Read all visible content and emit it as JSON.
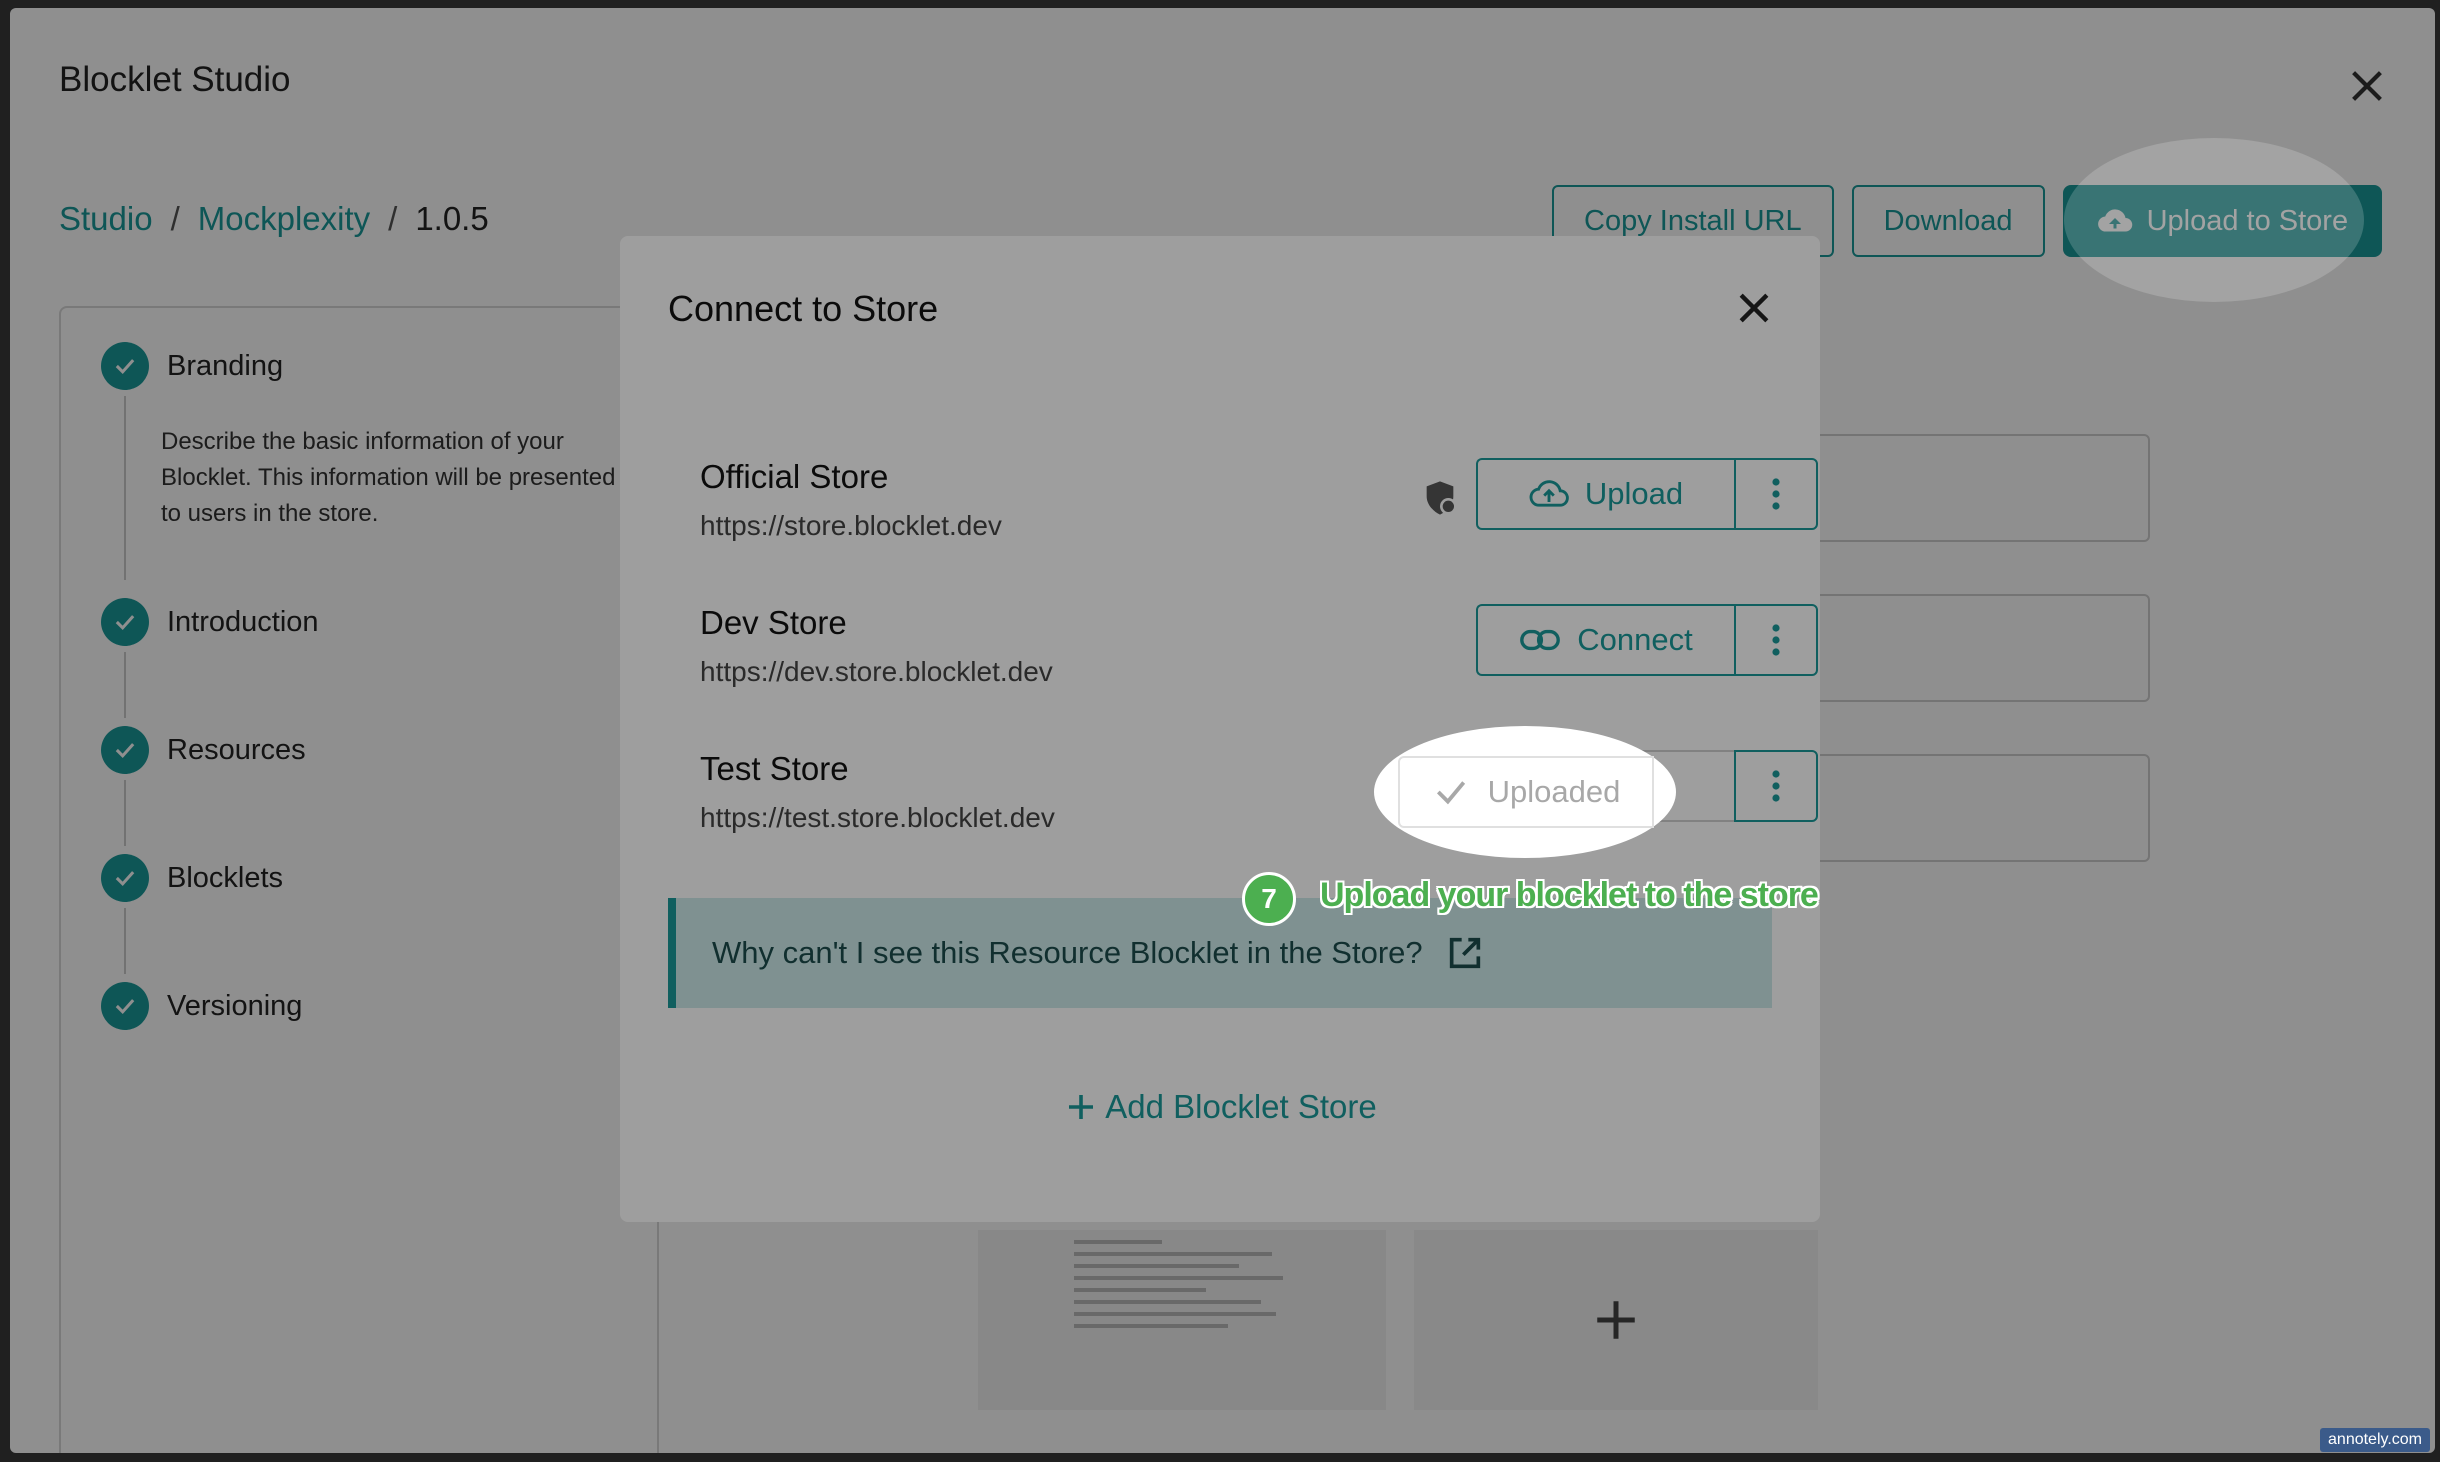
{
  "app": {
    "title": "Blocklet Studio"
  },
  "breadcrumb": {
    "items": [
      "Studio",
      "Mockplexity",
      "1.0.5"
    ],
    "separator": "/"
  },
  "toolbar": {
    "copy_install_url": "Copy Install URL",
    "download": "Download",
    "upload_to_store": "Upload to Store"
  },
  "steps": [
    {
      "label": "Branding",
      "description": "Describe the basic information of your Blocklet. This information will be presented to users in the store."
    },
    {
      "label": "Introduction"
    },
    {
      "label": "Resources"
    },
    {
      "label": "Blocklets"
    },
    {
      "label": "Versioning"
    }
  ],
  "modal": {
    "title": "Connect to Store",
    "stores": [
      {
        "name": "Official Store",
        "url": "https://store.blocklet.dev",
        "action": "Upload",
        "action_icon": "cloud-upload-icon"
      },
      {
        "name": "Dev Store",
        "url": "https://dev.store.blocklet.dev",
        "action": "Connect",
        "action_icon": "link-icon"
      },
      {
        "name": "Test Store",
        "url": "https://test.store.blocklet.dev",
        "action": "Uploaded",
        "action_icon": "check-icon"
      }
    ],
    "info_text": "Why can't I see this Resource Blocklet in the Store?",
    "add_store": "Add Blocklet Store"
  },
  "callout": {
    "number": "7",
    "text": "Upload your blocklet to the store"
  },
  "watermark": "annotely.com",
  "colors": {
    "accent": "#1a9a9a",
    "callout": "#4caf50"
  }
}
